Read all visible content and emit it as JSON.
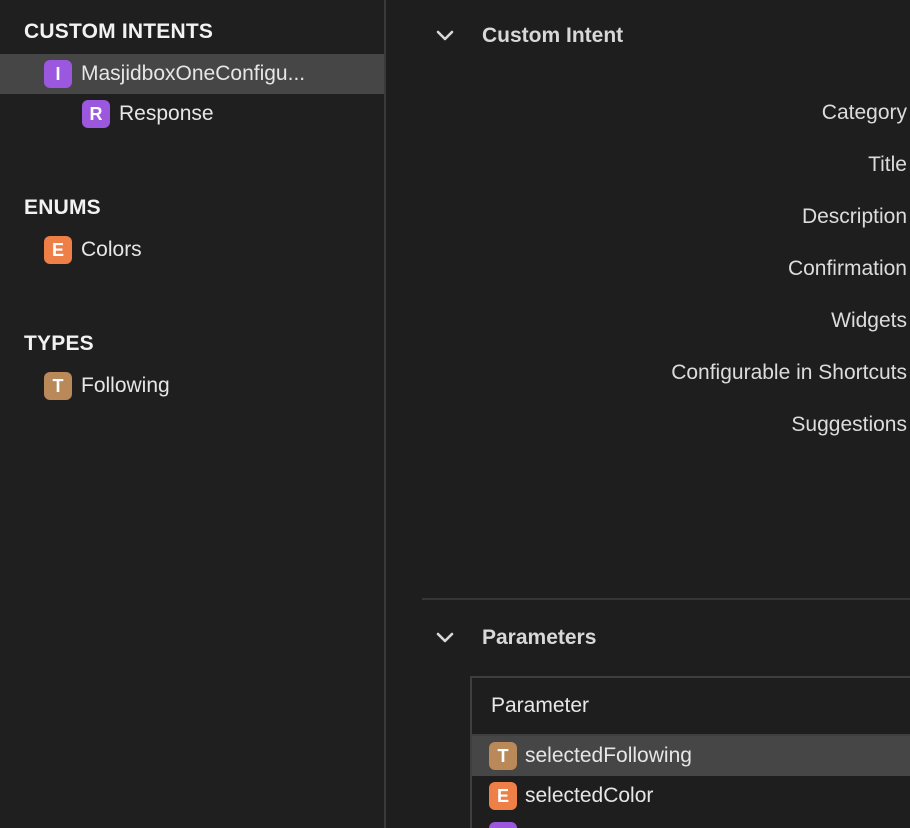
{
  "sidebar": {
    "sections": [
      {
        "title": "CUSTOM INTENTS"
      },
      {
        "title": "ENUMS"
      },
      {
        "title": "TYPES"
      }
    ],
    "items": [
      {
        "badge": "I",
        "label": "MasjidboxOneConfigu...",
        "color": "#9b57dd"
      },
      {
        "badge": "R",
        "label": "Response",
        "color": "#9b57dd"
      },
      {
        "badge": "E",
        "label": "Colors",
        "color": "#ee7f47"
      },
      {
        "badge": "T",
        "label": "Following",
        "color": "#b9895a"
      }
    ]
  },
  "main": {
    "intent_group": {
      "title": "Custom Intent",
      "fields": [
        "Category",
        "Title",
        "Description",
        "Confirmation",
        "Widgets",
        "Configurable in Shortcuts",
        "Suggestions"
      ]
    },
    "parameters_group": {
      "title": "Parameters",
      "table": {
        "header": "Parameter",
        "rows": [
          {
            "badge": "T",
            "label": "selectedFollowing",
            "color": "#b9895a"
          },
          {
            "badge": "E",
            "label": "selectedColor",
            "color": "#ee7f47"
          },
          {
            "badge": "",
            "label": "",
            "color": "#9b57dd"
          }
        ]
      }
    }
  },
  "colors": {
    "background": "#1e1e1e",
    "selection": "#464646",
    "purple_badge": "#9b57dd",
    "orange_badge": "#ee7f47",
    "tan_badge": "#b9895a"
  }
}
